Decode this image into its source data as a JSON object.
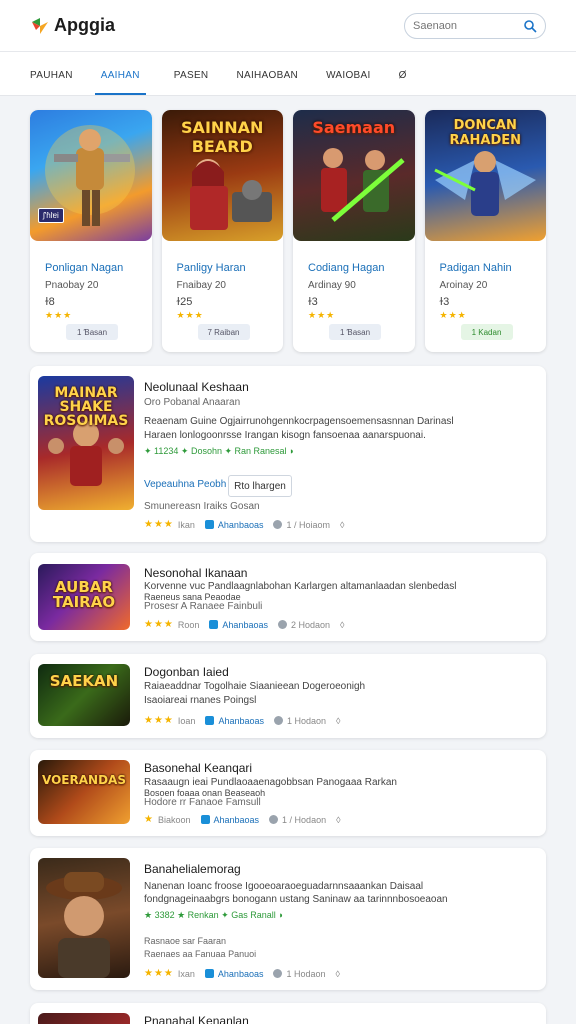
{
  "app": {
    "name": "Apggia",
    "search_placeholder": "Saenaon"
  },
  "tabs": [
    "PAUHAN",
    "AAIHAN",
    "PASEN",
    "NAIHAOBAN",
    "WAIOBAI",
    "Ø"
  ],
  "featured": [
    {
      "art_title": "",
      "badge": "ʃ'ɦlɐi",
      "name": "Ponligan Nagan",
      "sub": "Pnaobay 20",
      "num": "ɫ8",
      "stars": "★★★",
      "btn": "1 Ɓasan"
    },
    {
      "art_title": "SAINNAN BEARD",
      "badge": "",
      "name": "Panligy Haran",
      "sub": "Fnaibay 20",
      "num": "ɫ25",
      "stars": "★★★",
      "btn": "7 Raiban"
    },
    {
      "art_title": "Saemaan",
      "badge": "",
      "name": "Codiang Hagan",
      "sub": "Ardinay 90",
      "num": "ɫ3",
      "stars": "★★★",
      "btn": "1 Ɓasan"
    },
    {
      "art_title": "DONCAN RAHADEN",
      "badge": "",
      "name": "Padigan Nahin",
      "sub": "Aroinay 20",
      "num": "ɫ3",
      "stars": "★★★",
      "btn": "1 Kadan"
    }
  ],
  "list": [
    {
      "thumb_title": "MAINAR SHAKE ROSOIMAS",
      "title": "Neolunaal Keshaan",
      "sub": "Oro Pobanal Anaaran",
      "desc1": "Reaenam Guine Ogjairrunohgennkocrpagensoemensasnnan Darinasl",
      "desc2": "Haraen lonlogoonrsse Irangan kisogn fansoenaa aanarspuonai.",
      "green": "✦ 11234 ✦ Dosohn ✦ Ran Ranesal ◗",
      "blue": "Vepeauhna Peobh",
      "btn": "Rto lhargen",
      "extra": "Smunereasn Iraiks Gosan",
      "stars": "★★★",
      "m1": "Ikan",
      "m2": "Ahanbaoas",
      "m3": "1 / Hoiaom"
    },
    {
      "thumb_title": "AUBAR TAIRAO",
      "title": "Nesonohal Ikanaan",
      "sub": "",
      "desc1": "Korvenne vuc Pandlaagnlabohan Karlargen altamanlaadan slenbedasl",
      "desc2": "Raeneus sana Peaodae",
      "green": "",
      "blue": "",
      "btn": "",
      "extra": "Prosesr A Ranaee Fainbuli",
      "stars": "★★★",
      "m1": "Roon",
      "m2": "Ahanbaoas",
      "m3": "2 Hodaon"
    },
    {
      "thumb_title": "SAEKAN",
      "title": "Dogonban Iaied",
      "sub": "",
      "desc1": "Raiaeaddnar Togolhaie Siaanieean Dogeroeonigh",
      "desc2": "Isaoiareai rnanes Poingsl",
      "green": "",
      "blue": "",
      "btn": "",
      "extra": "",
      "stars": "★★★",
      "m1": "Ioan",
      "m2": "Ahanbaoas",
      "m3": "1 Hodaon"
    },
    {
      "thumb_title": "VOERANDAS",
      "title": "Basonehal Keanqari",
      "sub": "",
      "desc1": "Rasaaugn ieai Pundlaoaaenagobbsan Panogaaa Rarkan",
      "desc2": "Bosoen foaaa onan Beaseaoh",
      "green": "",
      "blue": "",
      "btn": "",
      "extra": "Hodore rr Fanaoe Famsull",
      "stars": "★",
      "m1": "Biakoon",
      "m2": "Ahanbaoas",
      "m3": "1 / Hodaon"
    },
    {
      "thumb_title": "",
      "title": "Banahelialemorag",
      "sub": "",
      "desc1": "Nanenan Ioanc froose Igooeoaraoeguadarnnsaaankan Daisaal",
      "desc2": "fondgnageinaabgrs bonogann ustang Saninaw aa tarinnnbosoeaoan",
      "green": "★ 3382 ★ Renkan ✦ Gas Ranall ◗",
      "blue": "",
      "btn": "",
      "extra": "Rasnaoe sar Faaran",
      "extra2": "Raenaes aa Fanuaa Panuoi",
      "stars": "★★★",
      "m1": "Ixan",
      "m2": "Ahanbaoas",
      "m3": "1 Hodaon"
    },
    {
      "thumb_title": "",
      "title": "Pnanahal Kenanlan",
      "sub": "",
      "desc1": "",
      "desc2": "",
      "green": "",
      "blue": "",
      "btn": "",
      "extra": "",
      "stars": "",
      "m1": "",
      "m2": "",
      "m3": ""
    }
  ]
}
